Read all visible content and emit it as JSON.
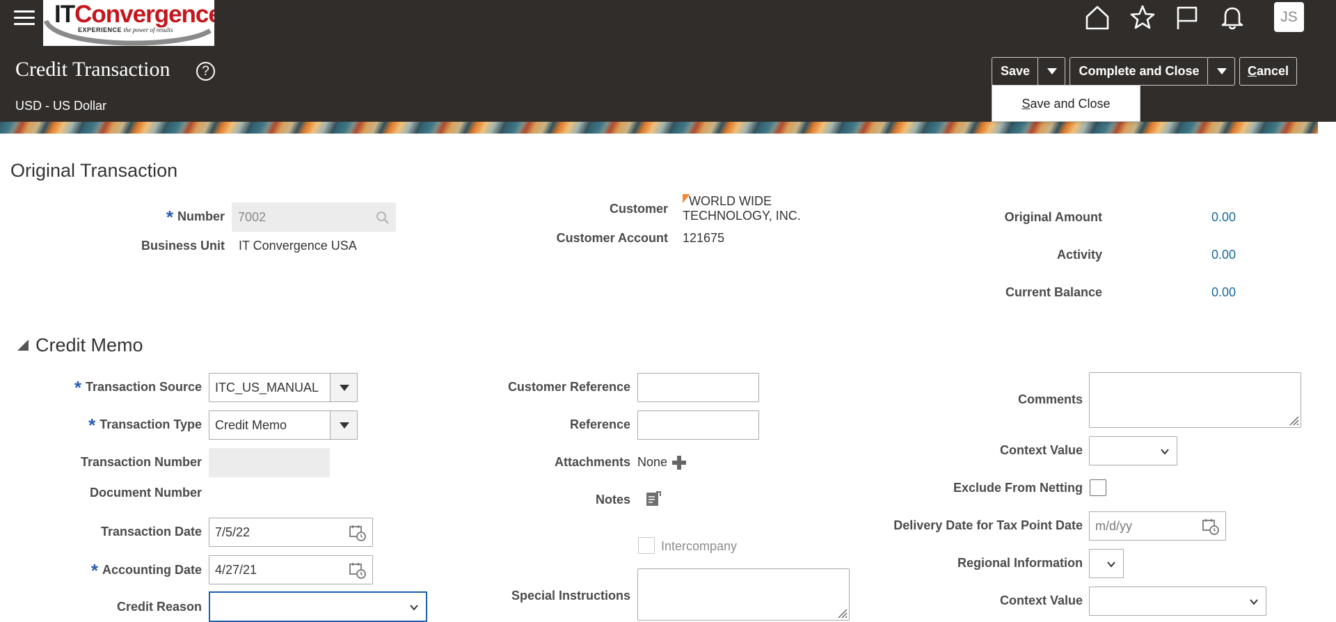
{
  "header": {
    "logo": {
      "it": "IT",
      "name": "Convergence",
      "tagline_bold": "EXPERIENCE",
      "tagline_rest": "the power of results"
    },
    "icons": [
      "home-icon",
      "star-icon",
      "flag-icon",
      "bell-icon"
    ],
    "avatar_initials": "JS",
    "page_title": "Credit Transaction",
    "help_glyph": "?",
    "currency": "USD - US Dollar"
  },
  "toolbar": {
    "save_label": "Save",
    "complete_close_label": "Complete and Close",
    "cancel_label": "Cancel",
    "cancel_mnemonic": "C",
    "cancel_rest": "ancel",
    "save_menu": {
      "item_label_mnemonic": "S",
      "item_label_rest": "ave and Close"
    }
  },
  "original_transaction": {
    "title": "Original Transaction",
    "number_label": "Number",
    "number_value": "7002",
    "business_unit_label": "Business Unit",
    "business_unit_value": "IT Convergence USA",
    "customer_label": "Customer",
    "customer_value_line1": "WORLD WIDE",
    "customer_value_line2": "TECHNOLOGY, INC.",
    "customer_account_label": "Customer Account",
    "customer_account_value": "121675",
    "original_amount_label": "Original Amount",
    "original_amount_value": "0.00",
    "activity_label": "Activity",
    "activity_value": "0.00",
    "current_balance_label": "Current Balance",
    "current_balance_value": "0.00"
  },
  "credit_memo": {
    "title": "Credit Memo",
    "transaction_source_label": "Transaction Source",
    "transaction_source_value": "ITC_US_MANUAL",
    "transaction_type_label": "Transaction Type",
    "transaction_type_value": "Credit Memo",
    "transaction_number_label": "Transaction Number",
    "transaction_number_value": "",
    "document_number_label": "Document Number",
    "transaction_date_label": "Transaction Date",
    "transaction_date_value": "7/5/22",
    "accounting_date_label": "Accounting Date",
    "accounting_date_value": "4/27/21",
    "credit_reason_label": "Credit Reason",
    "credit_reason_value": "",
    "customer_reference_label": "Customer Reference",
    "customer_reference_value": "",
    "reference_label": "Reference",
    "reference_value": "",
    "attachments_label": "Attachments",
    "attachments_value": "None",
    "notes_label": "Notes",
    "intercompany_label": "Intercompany",
    "special_instructions_label": "Special Instructions",
    "comments_label": "Comments",
    "context_value_label": "Context Value",
    "exclude_netting_label": "Exclude From Netting",
    "delivery_date_label": "Delivery Date for Tax Point Date",
    "delivery_date_placeholder": "m/d/yy",
    "regional_info_label": "Regional Information",
    "context_value2_label": "Context Value"
  },
  "colors": {
    "header_bg": "#312d2a",
    "required_star": "#2a5db0",
    "amount_link": "#1a6a9a",
    "focus_border": "#1b5fb0"
  }
}
